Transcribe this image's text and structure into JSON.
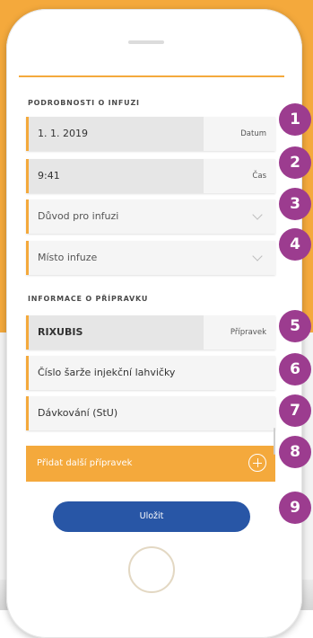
{
  "colors": {
    "accent": "#f4a93c",
    "badge": "#9c3c8f",
    "save": "#2856a6"
  },
  "infusion": {
    "section_title": "PODROBNOSTI O INFUZI",
    "date": {
      "value": "1. 1. 2019",
      "label": "Datum"
    },
    "time": {
      "value": "9:41",
      "label": "Čas"
    },
    "reason": {
      "placeholder": "Důvod pro infuzi",
      "icon": "chevron-down-icon"
    },
    "site": {
      "placeholder": "Místo infuze",
      "icon": "chevron-down-icon"
    }
  },
  "product": {
    "section_title": "INFORMACE O PŘÍPRAVKU",
    "name": {
      "value": "RIXUBIS",
      "label": "Přípravek"
    },
    "batch": {
      "placeholder": "Číslo šarže injekční lahvičky"
    },
    "dosage": {
      "placeholder": "Dávkování (StU)"
    }
  },
  "add_product": {
    "label": "Přidat další přípravek",
    "icon": "plus-circle-icon"
  },
  "save": {
    "label": "Uložit"
  },
  "badges": [
    "1",
    "2",
    "3",
    "4",
    "5",
    "6",
    "7",
    "8",
    "9"
  ]
}
